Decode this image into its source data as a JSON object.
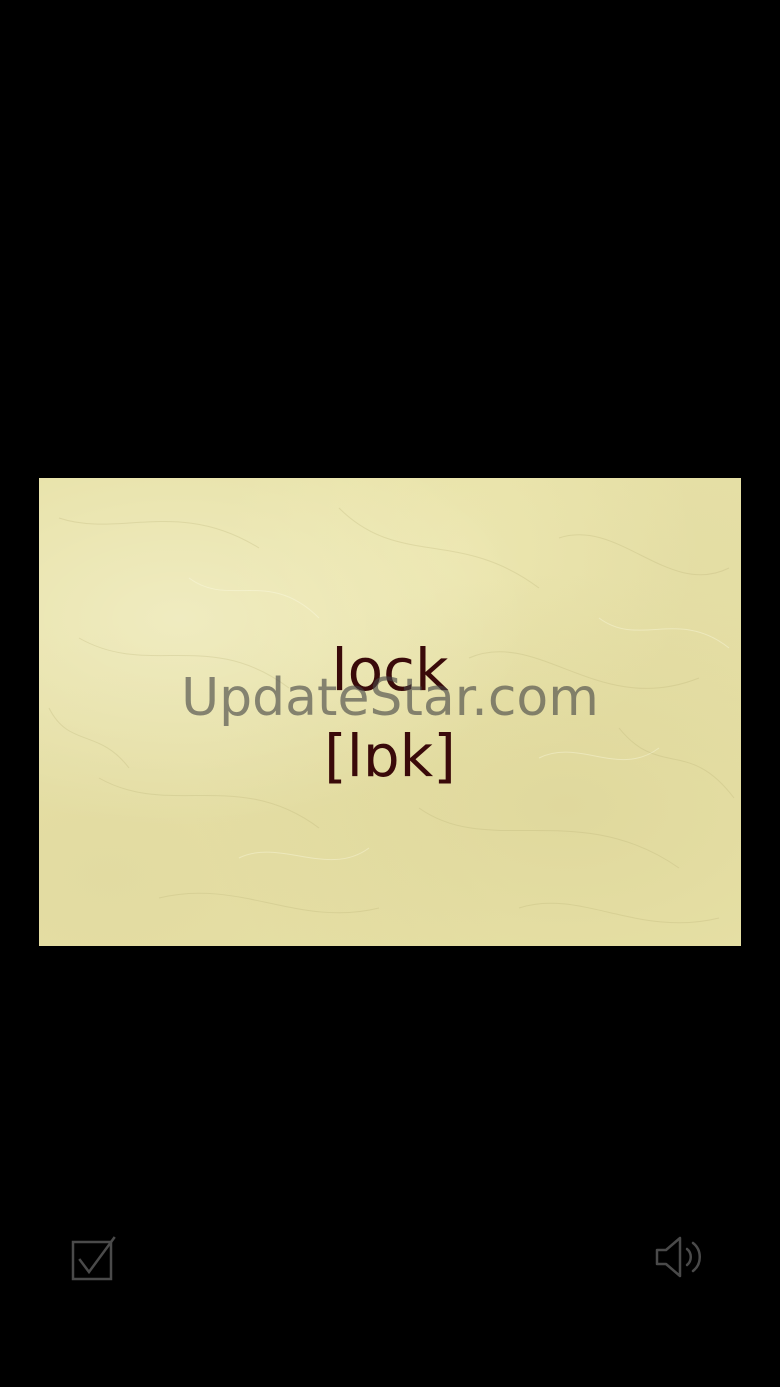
{
  "card": {
    "word": "lock",
    "phonetic": "[lɒk]",
    "watermark": "UpdateStar.com"
  },
  "controls": {
    "known_icon": "checkbox-checked-icon",
    "audio_icon": "speaker-icon"
  },
  "colors": {
    "background": "#000000",
    "card": "#e7e1a6",
    "text": "#3a0a0a",
    "icon": "#4a4a4a"
  }
}
